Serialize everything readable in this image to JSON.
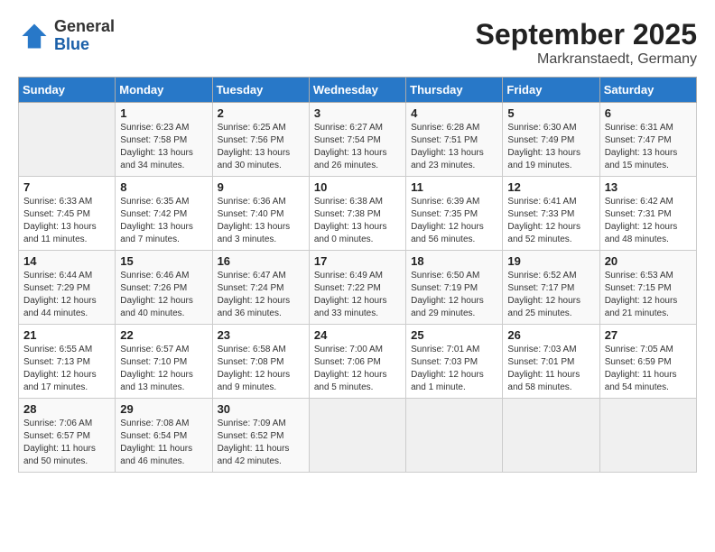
{
  "header": {
    "logo_general": "General",
    "logo_blue": "Blue",
    "month": "September 2025",
    "location": "Markranstaedt, Germany"
  },
  "weekdays": [
    "Sunday",
    "Monday",
    "Tuesday",
    "Wednesday",
    "Thursday",
    "Friday",
    "Saturday"
  ],
  "weeks": [
    [
      {
        "day": "",
        "empty": true
      },
      {
        "day": "1",
        "sunrise": "Sunrise: 6:23 AM",
        "sunset": "Sunset: 7:58 PM",
        "daylight": "Daylight: 13 hours and 34 minutes."
      },
      {
        "day": "2",
        "sunrise": "Sunrise: 6:25 AM",
        "sunset": "Sunset: 7:56 PM",
        "daylight": "Daylight: 13 hours and 30 minutes."
      },
      {
        "day": "3",
        "sunrise": "Sunrise: 6:27 AM",
        "sunset": "Sunset: 7:54 PM",
        "daylight": "Daylight: 13 hours and 26 minutes."
      },
      {
        "day": "4",
        "sunrise": "Sunrise: 6:28 AM",
        "sunset": "Sunset: 7:51 PM",
        "daylight": "Daylight: 13 hours and 23 minutes."
      },
      {
        "day": "5",
        "sunrise": "Sunrise: 6:30 AM",
        "sunset": "Sunset: 7:49 PM",
        "daylight": "Daylight: 13 hours and 19 minutes."
      },
      {
        "day": "6",
        "sunrise": "Sunrise: 6:31 AM",
        "sunset": "Sunset: 7:47 PM",
        "daylight": "Daylight: 13 hours and 15 minutes."
      }
    ],
    [
      {
        "day": "7",
        "sunrise": "Sunrise: 6:33 AM",
        "sunset": "Sunset: 7:45 PM",
        "daylight": "Daylight: 13 hours and 11 minutes."
      },
      {
        "day": "8",
        "sunrise": "Sunrise: 6:35 AM",
        "sunset": "Sunset: 7:42 PM",
        "daylight": "Daylight: 13 hours and 7 minutes."
      },
      {
        "day": "9",
        "sunrise": "Sunrise: 6:36 AM",
        "sunset": "Sunset: 7:40 PM",
        "daylight": "Daylight: 13 hours and 3 minutes."
      },
      {
        "day": "10",
        "sunrise": "Sunrise: 6:38 AM",
        "sunset": "Sunset: 7:38 PM",
        "daylight": "Daylight: 13 hours and 0 minutes."
      },
      {
        "day": "11",
        "sunrise": "Sunrise: 6:39 AM",
        "sunset": "Sunset: 7:35 PM",
        "daylight": "Daylight: 12 hours and 56 minutes."
      },
      {
        "day": "12",
        "sunrise": "Sunrise: 6:41 AM",
        "sunset": "Sunset: 7:33 PM",
        "daylight": "Daylight: 12 hours and 52 minutes."
      },
      {
        "day": "13",
        "sunrise": "Sunrise: 6:42 AM",
        "sunset": "Sunset: 7:31 PM",
        "daylight": "Daylight: 12 hours and 48 minutes."
      }
    ],
    [
      {
        "day": "14",
        "sunrise": "Sunrise: 6:44 AM",
        "sunset": "Sunset: 7:29 PM",
        "daylight": "Daylight: 12 hours and 44 minutes."
      },
      {
        "day": "15",
        "sunrise": "Sunrise: 6:46 AM",
        "sunset": "Sunset: 7:26 PM",
        "daylight": "Daylight: 12 hours and 40 minutes."
      },
      {
        "day": "16",
        "sunrise": "Sunrise: 6:47 AM",
        "sunset": "Sunset: 7:24 PM",
        "daylight": "Daylight: 12 hours and 36 minutes."
      },
      {
        "day": "17",
        "sunrise": "Sunrise: 6:49 AM",
        "sunset": "Sunset: 7:22 PM",
        "daylight": "Daylight: 12 hours and 33 minutes."
      },
      {
        "day": "18",
        "sunrise": "Sunrise: 6:50 AM",
        "sunset": "Sunset: 7:19 PM",
        "daylight": "Daylight: 12 hours and 29 minutes."
      },
      {
        "day": "19",
        "sunrise": "Sunrise: 6:52 AM",
        "sunset": "Sunset: 7:17 PM",
        "daylight": "Daylight: 12 hours and 25 minutes."
      },
      {
        "day": "20",
        "sunrise": "Sunrise: 6:53 AM",
        "sunset": "Sunset: 7:15 PM",
        "daylight": "Daylight: 12 hours and 21 minutes."
      }
    ],
    [
      {
        "day": "21",
        "sunrise": "Sunrise: 6:55 AM",
        "sunset": "Sunset: 7:13 PM",
        "daylight": "Daylight: 12 hours and 17 minutes."
      },
      {
        "day": "22",
        "sunrise": "Sunrise: 6:57 AM",
        "sunset": "Sunset: 7:10 PM",
        "daylight": "Daylight: 12 hours and 13 minutes."
      },
      {
        "day": "23",
        "sunrise": "Sunrise: 6:58 AM",
        "sunset": "Sunset: 7:08 PM",
        "daylight": "Daylight: 12 hours and 9 minutes."
      },
      {
        "day": "24",
        "sunrise": "Sunrise: 7:00 AM",
        "sunset": "Sunset: 7:06 PM",
        "daylight": "Daylight: 12 hours and 5 minutes."
      },
      {
        "day": "25",
        "sunrise": "Sunrise: 7:01 AM",
        "sunset": "Sunset: 7:03 PM",
        "daylight": "Daylight: 12 hours and 1 minute."
      },
      {
        "day": "26",
        "sunrise": "Sunrise: 7:03 AM",
        "sunset": "Sunset: 7:01 PM",
        "daylight": "Daylight: 11 hours and 58 minutes."
      },
      {
        "day": "27",
        "sunrise": "Sunrise: 7:05 AM",
        "sunset": "Sunset: 6:59 PM",
        "daylight": "Daylight: 11 hours and 54 minutes."
      }
    ],
    [
      {
        "day": "28",
        "sunrise": "Sunrise: 7:06 AM",
        "sunset": "Sunset: 6:57 PM",
        "daylight": "Daylight: 11 hours and 50 minutes."
      },
      {
        "day": "29",
        "sunrise": "Sunrise: 7:08 AM",
        "sunset": "Sunset: 6:54 PM",
        "daylight": "Daylight: 11 hours and 46 minutes."
      },
      {
        "day": "30",
        "sunrise": "Sunrise: 7:09 AM",
        "sunset": "Sunset: 6:52 PM",
        "daylight": "Daylight: 11 hours and 42 minutes."
      },
      {
        "day": "",
        "empty": true
      },
      {
        "day": "",
        "empty": true
      },
      {
        "day": "",
        "empty": true
      },
      {
        "day": "",
        "empty": true
      }
    ]
  ]
}
